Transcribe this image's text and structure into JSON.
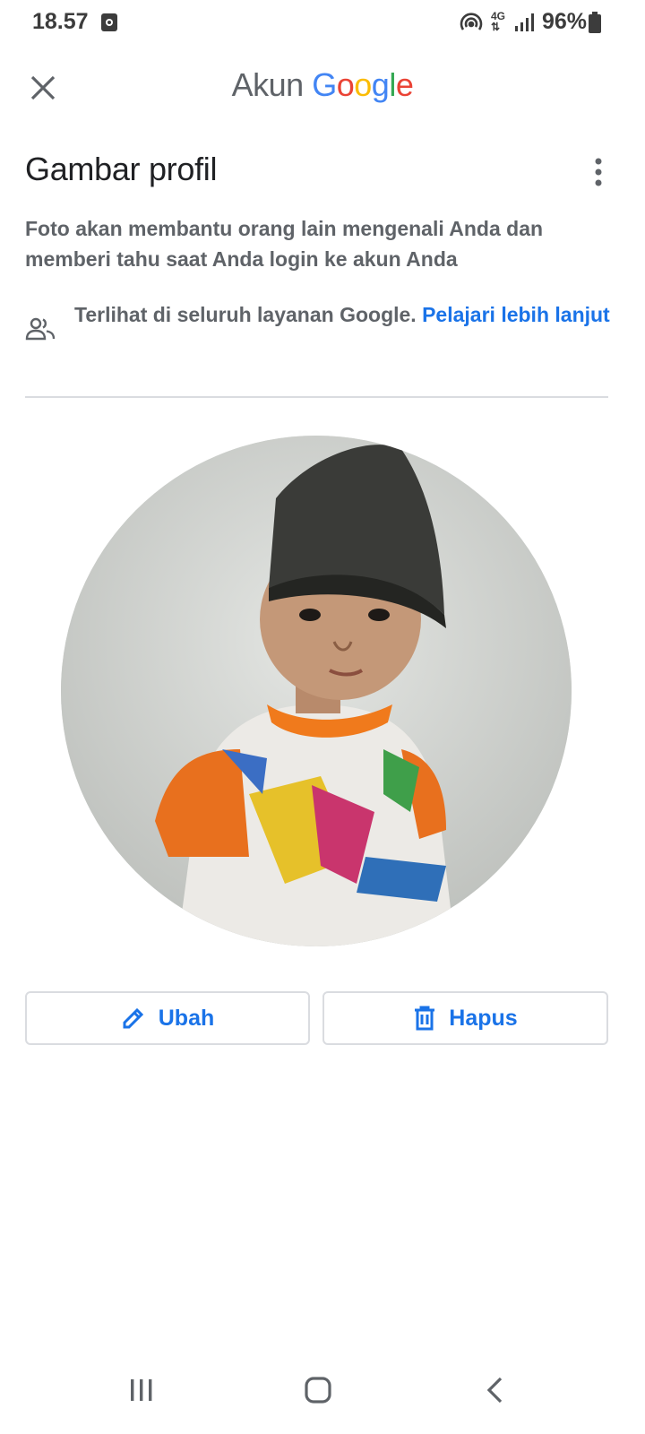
{
  "status_bar": {
    "time": "18.57",
    "network_type": "4G",
    "battery": "96%"
  },
  "header": {
    "app_title_prefix": "Akun",
    "app_title_brand_letters": [
      "G",
      "o",
      "o",
      "g",
      "l",
      "e"
    ]
  },
  "page": {
    "title": "Gambar profil",
    "description": "Foto akan membantu orang lain mengenali Anda dan memberi tahu saat Anda login ke akun Anda",
    "visibility_text": "Terlihat di seluruh layanan Google.",
    "learn_more_link": "Pelajari lebih lanjut"
  },
  "actions": {
    "edit_label": "Ubah",
    "delete_label": "Hapus"
  },
  "colors": {
    "accent": "#1a73e8",
    "google_blue": "#4285F4",
    "google_red": "#EA4335",
    "google_yellow": "#FBBC05",
    "google_green": "#34A853"
  },
  "icons": {
    "close": "close-icon",
    "more": "more-vert-icon",
    "people": "people-icon",
    "edit": "pencil-icon",
    "delete": "trash-icon"
  }
}
